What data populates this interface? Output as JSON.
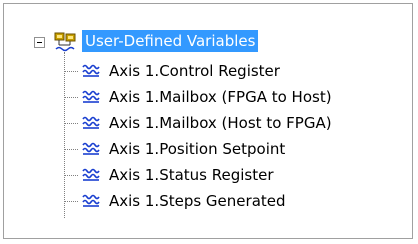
{
  "tree": {
    "root": {
      "label": "User-Defined Variables",
      "expanded": true,
      "selected": true,
      "icon": "network-variables-icon",
      "expander_icon": "collapse-minus-icon"
    },
    "items": [
      {
        "label": "Axis 1.Control Register",
        "icon": "variable-icon"
      },
      {
        "label": "Axis 1.Mailbox (FPGA to Host)",
        "icon": "variable-icon"
      },
      {
        "label": "Axis 1.Mailbox (Host to FPGA)",
        "icon": "variable-icon"
      },
      {
        "label": "Axis 1.Position Setpoint",
        "icon": "variable-icon"
      },
      {
        "label": "Axis 1.Status Register",
        "icon": "variable-icon"
      },
      {
        "label": "Axis 1.Steps Generated",
        "icon": "variable-icon"
      }
    ]
  },
  "colors": {
    "selection_background": "#3399ff",
    "selection_text": "#ffffff",
    "variable_icon": "#1a3fd0",
    "frame_border": "#a0a0a0"
  }
}
